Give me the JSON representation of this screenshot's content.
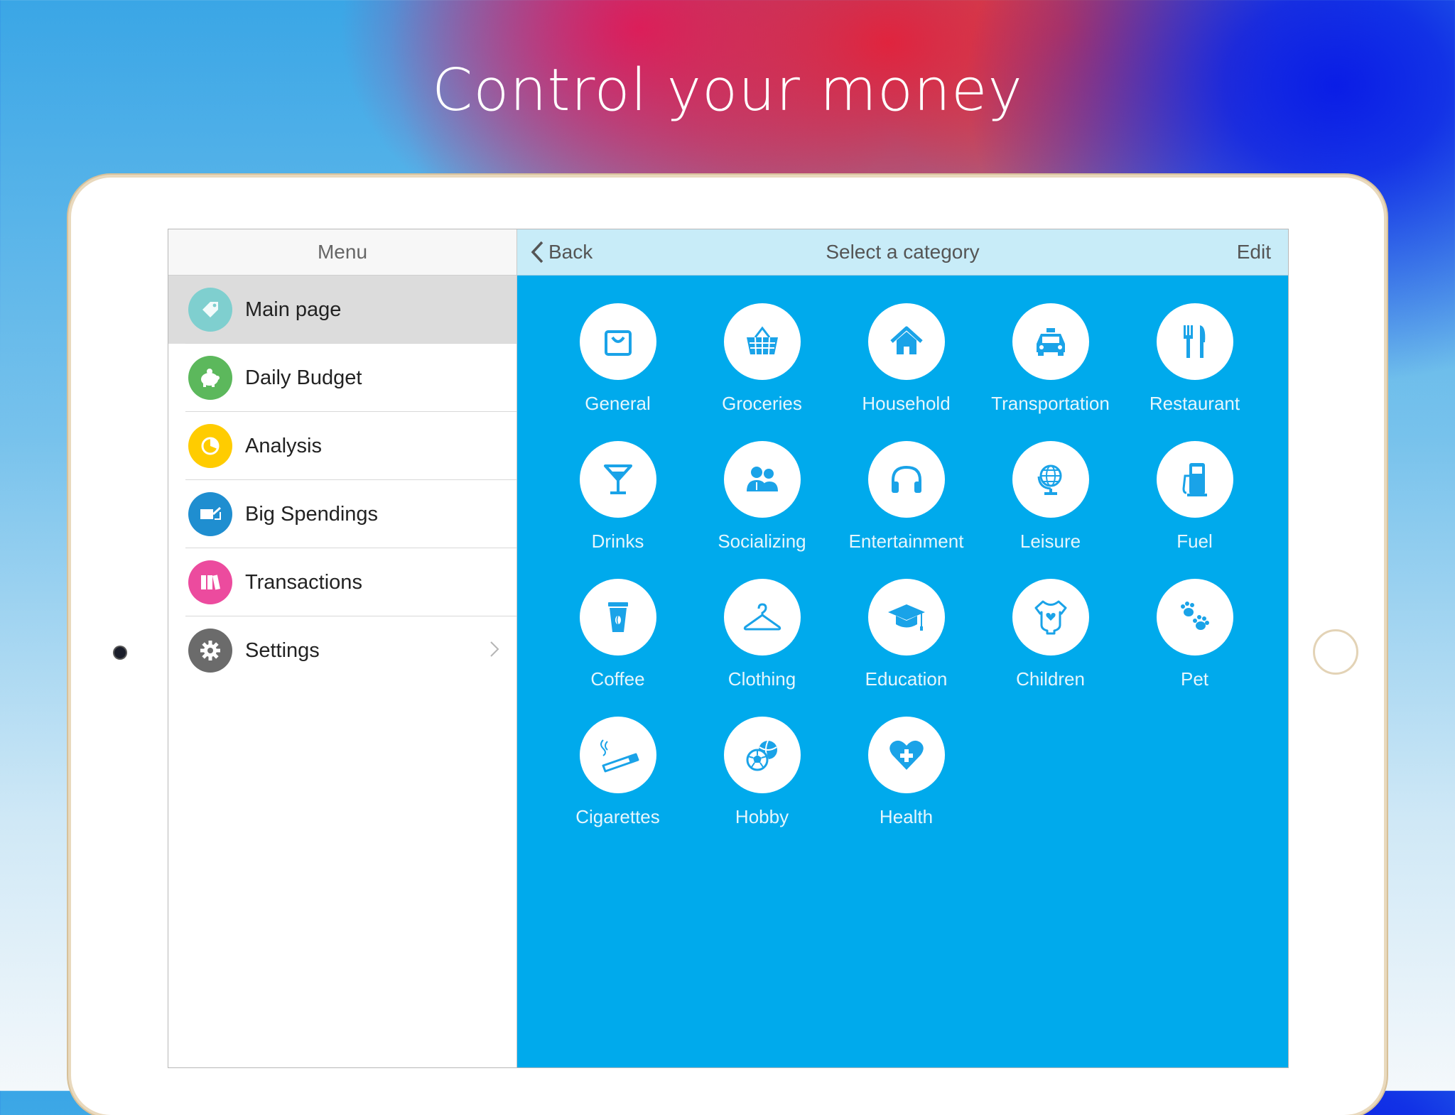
{
  "headline": "Control your money",
  "sidebar": {
    "title": "Menu",
    "items": [
      {
        "label": "Main page",
        "icon": "tag-icon",
        "color": "#7fcfcf"
      },
      {
        "label": "Daily Budget",
        "icon": "piggy-bank-icon",
        "color": "#5cb85c"
      },
      {
        "label": "Analysis",
        "icon": "pie-chart-icon",
        "color": "#ffcc00"
      },
      {
        "label": "Big Spendings",
        "icon": "wallet-icon",
        "color": "#1f8ed0"
      },
      {
        "label": "Transactions",
        "icon": "binders-icon",
        "color": "#ec4b9e"
      },
      {
        "label": "Settings",
        "icon": "gear-icon",
        "color": "#6b6b6b"
      }
    ]
  },
  "topbar": {
    "back_label": "Back",
    "title": "Select a category",
    "edit_label": "Edit"
  },
  "categories": [
    {
      "label": "General",
      "icon": "shopping-bag-icon"
    },
    {
      "label": "Groceries",
      "icon": "basket-icon"
    },
    {
      "label": "Household",
      "icon": "house-icon"
    },
    {
      "label": "Transportation",
      "icon": "taxi-icon"
    },
    {
      "label": "Restaurant",
      "icon": "fork-knife-icon"
    },
    {
      "label": "Drinks",
      "icon": "cocktail-icon"
    },
    {
      "label": "Socializing",
      "icon": "people-icon"
    },
    {
      "label": "Entertainment",
      "icon": "headphones-icon"
    },
    {
      "label": "Leisure",
      "icon": "globe-icon"
    },
    {
      "label": "Fuel",
      "icon": "fuel-pump-icon"
    },
    {
      "label": "Coffee",
      "icon": "coffee-cup-icon"
    },
    {
      "label": "Clothing",
      "icon": "hanger-icon"
    },
    {
      "label": "Education",
      "icon": "graduation-cap-icon"
    },
    {
      "label": "Children",
      "icon": "onesie-icon"
    },
    {
      "label": "Pet",
      "icon": "paw-icon"
    },
    {
      "label": "Cigarettes",
      "icon": "cigarette-icon"
    },
    {
      "label": "Hobby",
      "icon": "balls-icon"
    },
    {
      "label": "Health",
      "icon": "heart-plus-icon"
    }
  ],
  "colors": {
    "accent": "#00aaec",
    "topbar": "#c8ecf8",
    "icon": "#1aa3e8"
  }
}
